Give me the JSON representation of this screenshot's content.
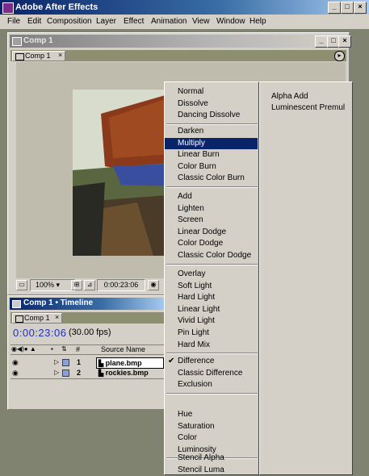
{
  "app": {
    "title": "Adobe After Effects",
    "menu": [
      "File",
      "Edit",
      "Composition",
      "Layer",
      "Effect",
      "Animation",
      "View",
      "Window",
      "Help"
    ]
  },
  "comp_window": {
    "title": "Comp 1",
    "tab": "Comp 1",
    "zoom": "100%",
    "timecode": "0:00:23:06"
  },
  "timeline": {
    "title": "Comp 1 • Timeline",
    "tab": "Comp 1",
    "timecode": "0:00:23:06",
    "fps": "(30.00 fps)",
    "col_num": "#",
    "col_source": "Source Name",
    "layers": [
      {
        "num": "1",
        "name": "plane.bmp"
      },
      {
        "num": "2",
        "name": "rockies.bmp"
      }
    ]
  },
  "blend_menu": {
    "groups": [
      [
        "Normal",
        "Dissolve",
        "Dancing Dissolve"
      ],
      [
        "Darken",
        "Multiply",
        "Linear Burn",
        "Color Burn",
        "Classic Color Burn"
      ],
      [
        "Add",
        "Lighten",
        "Screen",
        "Linear Dodge",
        "Color Dodge",
        "Classic Color Dodge"
      ],
      [
        "Overlay",
        "Soft Light",
        "Hard Light",
        "Linear Light",
        "Vivid Light",
        "Pin Light",
        "Hard Mix"
      ],
      [
        "Difference",
        "Classic Difference",
        "Exclusion"
      ],
      [
        "Hue",
        "Saturation",
        "Color",
        "Luminosity"
      ],
      [
        "Stencil Alpha",
        "Stencil Luma"
      ]
    ],
    "highlighted": "Multiply",
    "checked": "Difference",
    "secondary": [
      "Alpha Add",
      "Luminescent Premul"
    ],
    "check_glyph": "✔"
  },
  "colors": {
    "selection": "#0a246a",
    "title_active": "#0a246a",
    "face": "#d4d0c8",
    "timecode": "#2030c0"
  }
}
